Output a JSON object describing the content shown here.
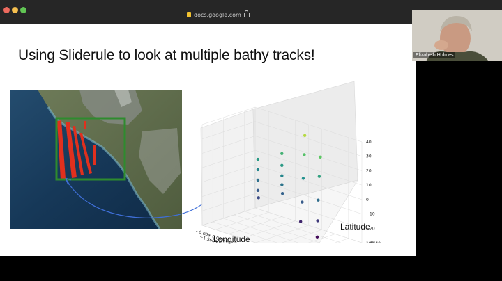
{
  "browser": {
    "address": "docs.google.com"
  },
  "slide": {
    "title": "Using Sliderule to look at multiple bathy tracks!",
    "xlabel": "Longitude",
    "ylabel": "Latitude",
    "x_ticks": [
      "−0.004",
      "−0.003",
      "−0.002",
      "−0.001",
      "0.000",
      "0.001",
      "0.002",
      "0.003",
      "0.004"
    ],
    "x_offset": "−1.56000000e2",
    "y_ticks": [
      "19.630",
      "19.632",
      "19.634",
      "19.636",
      "19.638",
      "19.640"
    ],
    "z_ticks": [
      "40",
      "30",
      "20",
      "10",
      "0",
      "−10",
      "−20",
      "−30"
    ]
  },
  "video": {
    "participant_name": "Elizabeth Holmes"
  },
  "colors": {
    "track_red": "#e0301e",
    "box_green": "#2e8b2e",
    "arrow_blue": "#3f6fd8"
  },
  "chart_data": {
    "type": "scatter",
    "title": "",
    "xlabel": "Longitude",
    "ylabel": "Latitude",
    "zlabel": "",
    "xlim": [
      -0.004,
      0.004
    ],
    "x_offset": -156.0,
    "ylim": [
      19.63,
      19.64
    ],
    "zlim": [
      -30,
      40
    ],
    "grid": true,
    "colormap": "viridis",
    "series": [
      {
        "points": [
          [
            -0.0032,
            19.6385,
            8
          ],
          [
            -0.003,
            19.638,
            2
          ],
          [
            -0.0028,
            19.6375,
            -4
          ],
          [
            -0.0026,
            19.637,
            -10
          ],
          [
            -0.0024,
            19.6366,
            -14
          ]
        ]
      },
      {
        "points": [
          [
            -0.0018,
            19.6395,
            15
          ],
          [
            -0.0016,
            19.639,
            8
          ],
          [
            -0.0014,
            19.6385,
            2
          ],
          [
            -0.0012,
            19.638,
            -3
          ],
          [
            -0.001,
            19.6376,
            -8
          ]
        ]
      },
      {
        "points": [
          [
            -0.0002,
            19.6398,
            32
          ],
          [
            0.0,
            19.6392,
            20
          ],
          [
            0.0002,
            19.6385,
            5
          ],
          [
            0.0004,
            19.6378,
            -10
          ],
          [
            0.0006,
            19.637,
            -22
          ]
        ]
      },
      {
        "points": [
          [
            0.0012,
            19.6392,
            22
          ],
          [
            0.0014,
            19.6385,
            10
          ],
          [
            0.0016,
            19.6378,
            -5
          ],
          [
            0.0018,
            19.6372,
            -18
          ],
          [
            0.002,
            19.6366,
            -28
          ]
        ]
      }
    ]
  }
}
